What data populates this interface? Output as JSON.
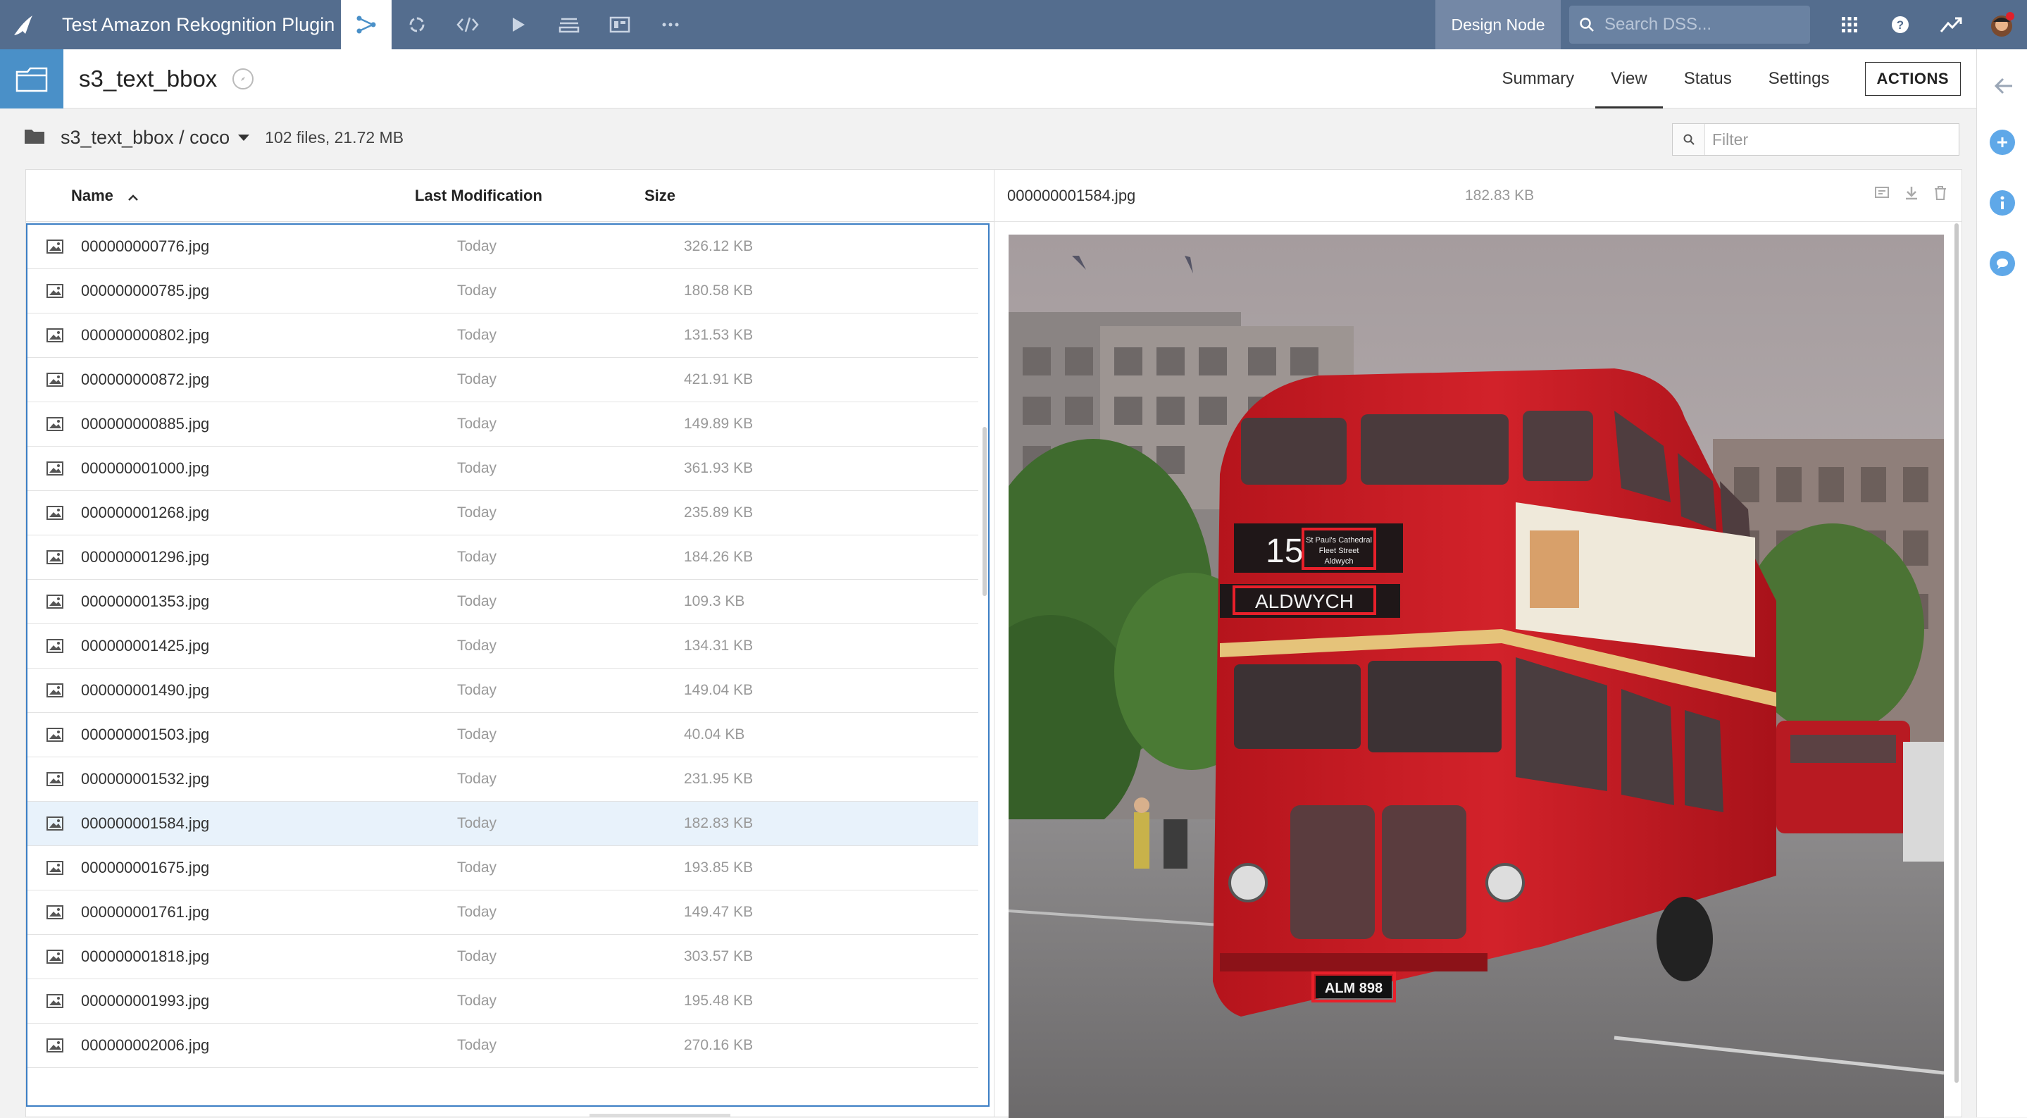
{
  "navbar": {
    "project_title": "Test Amazon Rekognition Plugin",
    "design_node": "Design Node",
    "search_placeholder": "Search DSS...",
    "icons": [
      "flow-icon",
      "jobs-icon",
      "code-icon",
      "run-icon",
      "datasets-icon",
      "dashboard-icon",
      "more-icon",
      "apps-grid-icon",
      "help-icon",
      "activity-icon",
      "user-avatar-icon"
    ],
    "colors": {
      "bar": "#546d8e",
      "design_node_bg": "#7488a6",
      "accent": "#4a90c8"
    }
  },
  "object": {
    "name": "s3_text_bbox",
    "tabs": [
      {
        "label": "Summary",
        "active": false
      },
      {
        "label": "View",
        "active": true
      },
      {
        "label": "Status",
        "active": false
      },
      {
        "label": "Settings",
        "active": false
      }
    ],
    "actions_label": "ACTIONS"
  },
  "path": {
    "breadcrumb": "s3_text_bbox / coco",
    "summary": "102 files, 21.72 MB",
    "filter_placeholder": "Filter"
  },
  "file_list": {
    "columns": {
      "name": "Name",
      "modified": "Last Modification",
      "size": "Size"
    },
    "sort": "name-ascending",
    "selected_index": 13,
    "rows": [
      {
        "name": "000000000776.jpg",
        "modified": "Today",
        "size": "326.12 KB"
      },
      {
        "name": "000000000785.jpg",
        "modified": "Today",
        "size": "180.58 KB"
      },
      {
        "name": "000000000802.jpg",
        "modified": "Today",
        "size": "131.53 KB"
      },
      {
        "name": "000000000872.jpg",
        "modified": "Today",
        "size": "421.91 KB"
      },
      {
        "name": "000000000885.jpg",
        "modified": "Today",
        "size": "149.89 KB"
      },
      {
        "name": "000000001000.jpg",
        "modified": "Today",
        "size": "361.93 KB"
      },
      {
        "name": "000000001268.jpg",
        "modified": "Today",
        "size": "235.89 KB"
      },
      {
        "name": "000000001296.jpg",
        "modified": "Today",
        "size": "184.26 KB"
      },
      {
        "name": "000000001353.jpg",
        "modified": "Today",
        "size": "109.3 KB"
      },
      {
        "name": "000000001425.jpg",
        "modified": "Today",
        "size": "134.31 KB"
      },
      {
        "name": "000000001490.jpg",
        "modified": "Today",
        "size": "149.04 KB"
      },
      {
        "name": "000000001503.jpg",
        "modified": "Today",
        "size": "40.04 KB"
      },
      {
        "name": "000000001532.jpg",
        "modified": "Today",
        "size": "231.95 KB"
      },
      {
        "name": "000000001584.jpg",
        "modified": "Today",
        "size": "182.83 KB"
      },
      {
        "name": "000000001675.jpg",
        "modified": "Today",
        "size": "193.85 KB"
      },
      {
        "name": "000000001761.jpg",
        "modified": "Today",
        "size": "149.47 KB"
      },
      {
        "name": "000000001818.jpg",
        "modified": "Today",
        "size": "303.57 KB"
      },
      {
        "name": "000000001993.jpg",
        "modified": "Today",
        "size": "195.48 KB"
      },
      {
        "name": "000000002006.jpg",
        "modified": "Today",
        "size": "270.16 KB"
      }
    ]
  },
  "preview": {
    "file_name": "000000001584.jpg",
    "file_size": "182.83 KB",
    "action_icons": [
      "open-tab-icon",
      "download-icon",
      "delete-icon"
    ],
    "image_text": {
      "route_number": "15",
      "destination": "ALDWYCH",
      "via_line1": "St Paul's Cathedral",
      "via_line2": "Fleet Street",
      "via_line3": "Aldwych",
      "plate": "ALM 898"
    }
  }
}
